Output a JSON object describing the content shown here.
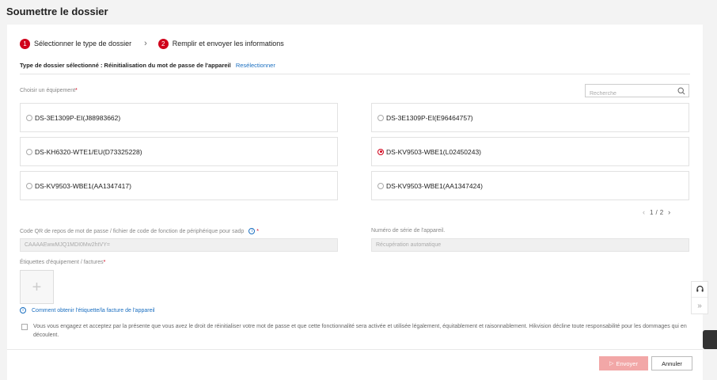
{
  "page": {
    "title": "Soumettre le dossier"
  },
  "steps": [
    {
      "number": "1",
      "label": "Sélectionner le type de dossier"
    },
    {
      "number": "2",
      "label": "Remplir et envoyer les informations"
    }
  ],
  "selected_type": {
    "prefix": "Type de dossier sélectionné : Réinitialisation du mot de passe de l'appareil",
    "reselect_link": "Resélectionner"
  },
  "equipment": {
    "label": "Choisir un équipement",
    "required_mark": "*",
    "search_placeholder": "Recherche",
    "devices": [
      {
        "name": "DS-3E1309P-EI(J88983662)",
        "selected": false
      },
      {
        "name": "DS-3E1309P-EI(E96464757)",
        "selected": false
      },
      {
        "name": "DS-KH6320-WTE1/EU(D73325228)",
        "selected": false
      },
      {
        "name": "DS-KV9503-WBE1(L02450243)",
        "selected": true
      },
      {
        "name": "DS-KV9503-WBE1(AA1347417)",
        "selected": false
      },
      {
        "name": "DS-KV9503-WBE1(AA1347424)",
        "selected": false
      }
    ],
    "pagination": {
      "current": "1",
      "separator": "/",
      "total": "2"
    }
  },
  "qr_field": {
    "label": "Code QR de repos de mot de passe / fichier de code de fonction de périphérique pour sadp",
    "required_mark": "*",
    "value": "CAAAAEwwMJQ1MDI0Mw2htVY="
  },
  "serial_field": {
    "label": "Numéro de série de l'appareil.",
    "value": "Récupération automatique"
  },
  "labels_field": {
    "label": "Étiquettes d'équipement / factures",
    "required_mark": "*",
    "upload_symbol": "+"
  },
  "help": {
    "text": "Comment obtenir l'étiquette/la facture de l'appareil",
    "icon": "info-icon"
  },
  "consent": {
    "text": "Vous vous engagez et acceptez par la présente que vous avez le droit de réinitialiser votre mot de passe et que cette fonctionnalité sera activée et utilisée légalement, équitablement et raisonnablement. Hikvision décline toute responsabilité pour les dommages qui en découlent."
  },
  "actions": {
    "send_label": "Envoyer",
    "cancel_label": "Annuler"
  },
  "colors": {
    "accent": "#d0021b",
    "link": "#1b6fc0",
    "send_disabled": "#f2a7a7"
  }
}
